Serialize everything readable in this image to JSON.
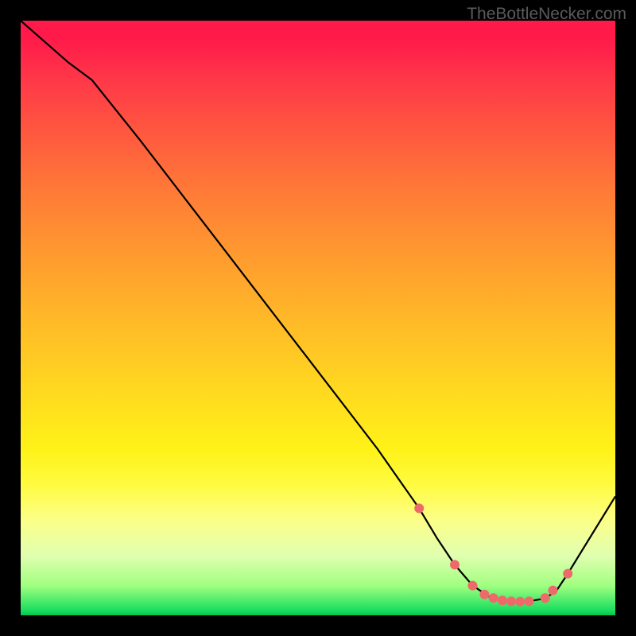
{
  "watermark": "TheBottleNecker.com",
  "chart_data": {
    "type": "line",
    "title": "",
    "xlabel": "",
    "ylabel": "",
    "xlim": [
      0,
      100
    ],
    "ylim": [
      0,
      100
    ],
    "series": [
      {
        "name": "bottleneck-curve",
        "x": [
          0,
          8,
          12,
          20,
          30,
          40,
          50,
          60,
          67,
          70,
          73,
          76,
          79,
          82,
          85,
          88,
          90,
          92,
          100
        ],
        "values": [
          100,
          93,
          90,
          80,
          67,
          54,
          41,
          28,
          18,
          13,
          8.5,
          5,
          3,
          2.3,
          2.3,
          2.8,
          4,
          7,
          20
        ],
        "color": "#000000"
      }
    ],
    "markers": {
      "name": "highlight-dots",
      "x": [
        67,
        73,
        76,
        78,
        79.5,
        81,
        82.5,
        84,
        85.5,
        88.2,
        89.5,
        92
      ],
      "values": [
        18,
        8.5,
        5,
        3.5,
        2.9,
        2.5,
        2.35,
        2.3,
        2.35,
        2.9,
        4.2,
        7
      ],
      "color": "#ee6a6a",
      "size": 6
    }
  }
}
